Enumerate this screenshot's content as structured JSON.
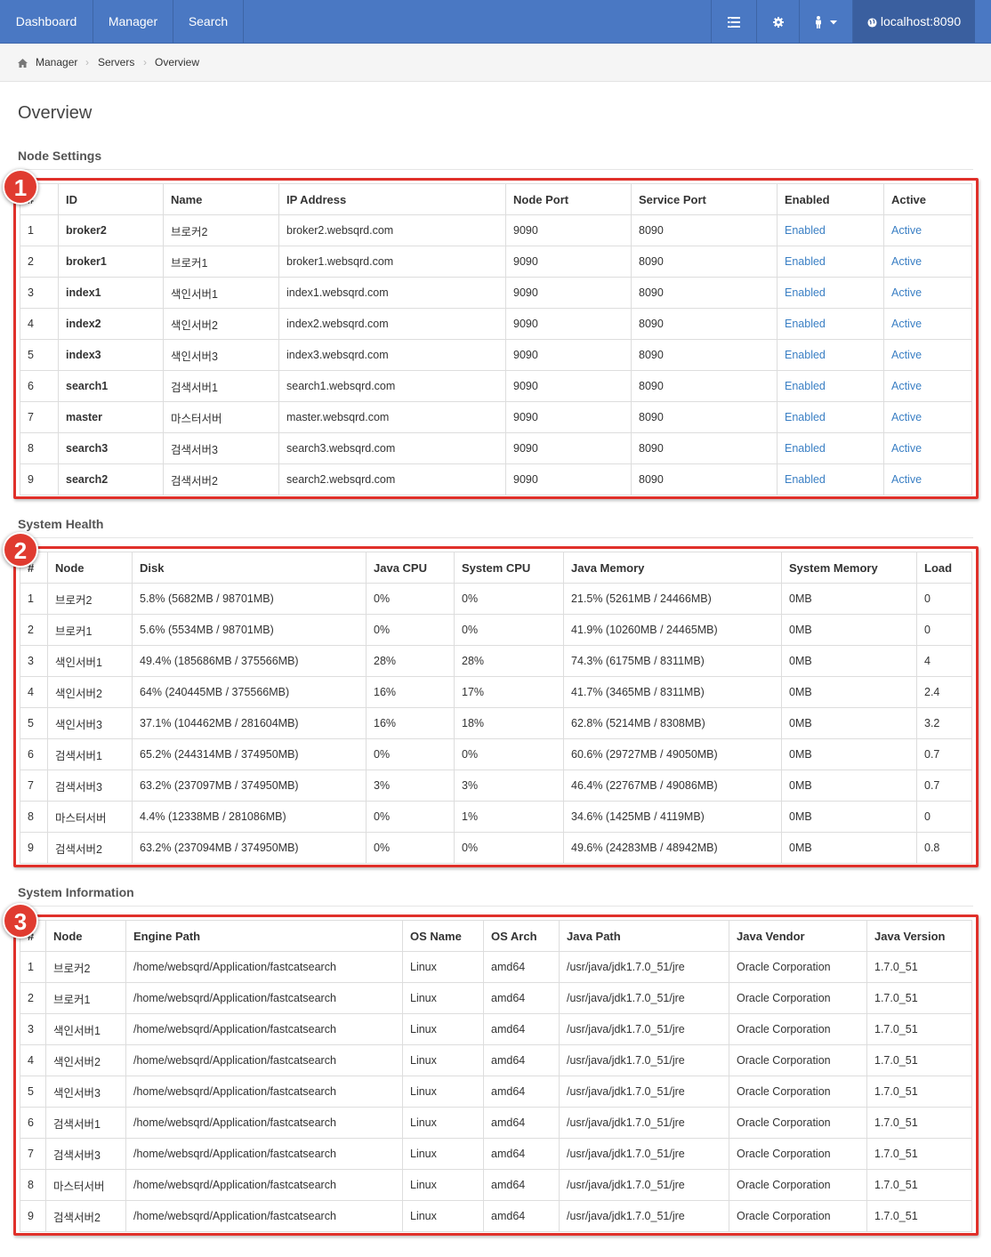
{
  "nav": {
    "dashboard": "Dashboard",
    "manager": "Manager",
    "search": "Search",
    "host": "localhost:8090"
  },
  "breadcrumb": [
    "Manager",
    "Servers",
    "Overview"
  ],
  "page_title": "Overview",
  "node_settings": {
    "title": "Node Settings",
    "headers": [
      "#",
      "ID",
      "Name",
      "IP Address",
      "Node Port",
      "Service Port",
      "Enabled",
      "Active"
    ],
    "rows": [
      [
        "1",
        "broker2",
        "브로커2",
        "broker2.websqrd.com",
        "9090",
        "8090",
        "Enabled",
        "Active"
      ],
      [
        "2",
        "broker1",
        "브로커1",
        "broker1.websqrd.com",
        "9090",
        "8090",
        "Enabled",
        "Active"
      ],
      [
        "3",
        "index1",
        "색인서버1",
        "index1.websqrd.com",
        "9090",
        "8090",
        "Enabled",
        "Active"
      ],
      [
        "4",
        "index2",
        "색인서버2",
        "index2.websqrd.com",
        "9090",
        "8090",
        "Enabled",
        "Active"
      ],
      [
        "5",
        "index3",
        "색인서버3",
        "index3.websqrd.com",
        "9090",
        "8090",
        "Enabled",
        "Active"
      ],
      [
        "6",
        "search1",
        "검색서버1",
        "search1.websqrd.com",
        "9090",
        "8090",
        "Enabled",
        "Active"
      ],
      [
        "7",
        "master",
        "마스터서버",
        "master.websqrd.com",
        "9090",
        "8090",
        "Enabled",
        "Active"
      ],
      [
        "8",
        "search3",
        "검색서버3",
        "search3.websqrd.com",
        "9090",
        "8090",
        "Enabled",
        "Active"
      ],
      [
        "9",
        "search2",
        "검색서버2",
        "search2.websqrd.com",
        "9090",
        "8090",
        "Enabled",
        "Active"
      ]
    ]
  },
  "system_health": {
    "title": "System Health",
    "headers": [
      "#",
      "Node",
      "Disk",
      "Java CPU",
      "System CPU",
      "Java Memory",
      "System Memory",
      "Load"
    ],
    "rows": [
      [
        "1",
        "브로커2",
        "5.8% (5682MB / 98701MB)",
        "0%",
        "0%",
        "21.5% (5261MB / 24466MB)",
        "0MB",
        "0"
      ],
      [
        "2",
        "브로커1",
        "5.6% (5534MB / 98701MB)",
        "0%",
        "0%",
        "41.9% (10260MB / 24465MB)",
        "0MB",
        "0"
      ],
      [
        "3",
        "색인서버1",
        "49.4% (185686MB / 375566MB)",
        "28%",
        "28%",
        "74.3% (6175MB / 8311MB)",
        "0MB",
        "4"
      ],
      [
        "4",
        "색인서버2",
        "64% (240445MB / 375566MB)",
        "16%",
        "17%",
        "41.7% (3465MB / 8311MB)",
        "0MB",
        "2.4"
      ],
      [
        "5",
        "색인서버3",
        "37.1% (104462MB / 281604MB)",
        "16%",
        "18%",
        "62.8% (5214MB / 8308MB)",
        "0MB",
        "3.2"
      ],
      [
        "6",
        "검색서버1",
        "65.2% (244314MB / 374950MB)",
        "0%",
        "0%",
        "60.6% (29727MB / 49050MB)",
        "0MB",
        "0.7"
      ],
      [
        "7",
        "검색서버3",
        "63.2% (237097MB / 374950MB)",
        "3%",
        "3%",
        "46.4% (22767MB / 49086MB)",
        "0MB",
        "0.7"
      ],
      [
        "8",
        "마스터서버",
        "4.4% (12338MB / 281086MB)",
        "0%",
        "1%",
        "34.6% (1425MB / 4119MB)",
        "0MB",
        "0"
      ],
      [
        "9",
        "검색서버2",
        "63.2% (237094MB / 374950MB)",
        "0%",
        "0%",
        "49.6% (24283MB / 48942MB)",
        "0MB",
        "0.8"
      ]
    ]
  },
  "system_information": {
    "title": "System Information",
    "headers": [
      "#",
      "Node",
      "Engine Path",
      "OS Name",
      "OS Arch",
      "Java Path",
      "Java Vendor",
      "Java Version"
    ],
    "rows": [
      [
        "1",
        "브로커2",
        "/home/websqrd/Application/fastcatsearch",
        "Linux",
        "amd64",
        "/usr/java/jdk1.7.0_51/jre",
        "Oracle Corporation",
        "1.7.0_51"
      ],
      [
        "2",
        "브로커1",
        "/home/websqrd/Application/fastcatsearch",
        "Linux",
        "amd64",
        "/usr/java/jdk1.7.0_51/jre",
        "Oracle Corporation",
        "1.7.0_51"
      ],
      [
        "3",
        "색인서버1",
        "/home/websqrd/Application/fastcatsearch",
        "Linux",
        "amd64",
        "/usr/java/jdk1.7.0_51/jre",
        "Oracle Corporation",
        "1.7.0_51"
      ],
      [
        "4",
        "색인서버2",
        "/home/websqrd/Application/fastcatsearch",
        "Linux",
        "amd64",
        "/usr/java/jdk1.7.0_51/jre",
        "Oracle Corporation",
        "1.7.0_51"
      ],
      [
        "5",
        "색인서버3",
        "/home/websqrd/Application/fastcatsearch",
        "Linux",
        "amd64",
        "/usr/java/jdk1.7.0_51/jre",
        "Oracle Corporation",
        "1.7.0_51"
      ],
      [
        "6",
        "검색서버1",
        "/home/websqrd/Application/fastcatsearch",
        "Linux",
        "amd64",
        "/usr/java/jdk1.7.0_51/jre",
        "Oracle Corporation",
        "1.7.0_51"
      ],
      [
        "7",
        "검색서버3",
        "/home/websqrd/Application/fastcatsearch",
        "Linux",
        "amd64",
        "/usr/java/jdk1.7.0_51/jre",
        "Oracle Corporation",
        "1.7.0_51"
      ],
      [
        "8",
        "마스터서버",
        "/home/websqrd/Application/fastcatsearch",
        "Linux",
        "amd64",
        "/usr/java/jdk1.7.0_51/jre",
        "Oracle Corporation",
        "1.7.0_51"
      ],
      [
        "9",
        "검색서버2",
        "/home/websqrd/Application/fastcatsearch",
        "Linux",
        "amd64",
        "/usr/java/jdk1.7.0_51/jre",
        "Oracle Corporation",
        "1.7.0_51"
      ]
    ]
  },
  "annotations": [
    "1",
    "2",
    "3"
  ],
  "colors": {
    "nav": "#4a78c3",
    "link": "#3a7fc4",
    "annotation_red": "#e0302a"
  }
}
